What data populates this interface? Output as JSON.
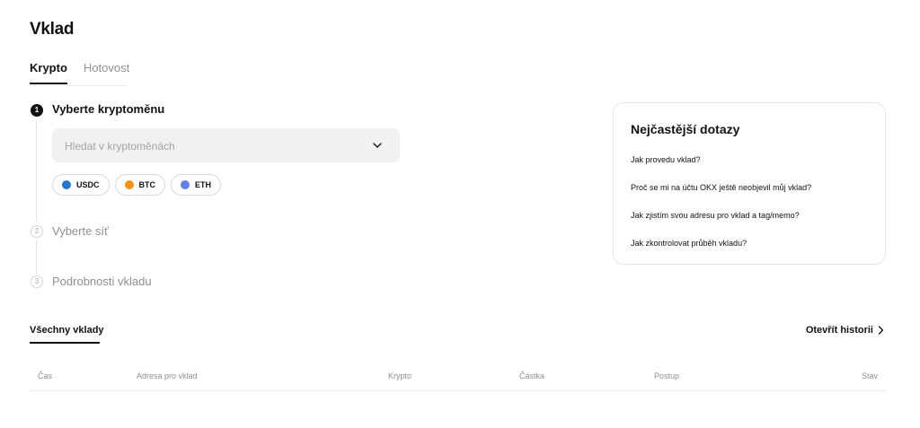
{
  "page": {
    "title": "Vklad"
  },
  "tabs": [
    {
      "label": "Krypto",
      "active": true
    },
    {
      "label": "Hotovost",
      "active": false
    }
  ],
  "steps": [
    {
      "number": "1",
      "title": "Vyberte kryptoměnu",
      "active": true
    },
    {
      "number": "2",
      "title": "Vyberte síť",
      "active": false
    },
    {
      "number": "3",
      "title": "Podrobnosti vkladu",
      "active": false
    }
  ],
  "search": {
    "placeholder": "Hledat v kryptoměnách",
    "value": ""
  },
  "quick_coins": [
    {
      "label": "USDC",
      "color": "#2775ca",
      "icon": "usdc-icon"
    },
    {
      "label": "BTC",
      "color": "#f7931a",
      "icon": "btc-icon"
    },
    {
      "label": "ETH",
      "color": "#627eea",
      "icon": "eth-icon"
    }
  ],
  "faq": {
    "title": "Nejčastější dotazy",
    "items": [
      "Jak provedu vklad?",
      "Proč se mi na účtu OKX ještě neobjevil můj vklad?",
      "Jak zjistím svou adresu pro vklad a tag/memo?",
      "Jak zkontrolovat průběh vkladu?"
    ]
  },
  "history": {
    "tab_label": "Všechny vklady",
    "open_label": "Otevřít historii",
    "columns": [
      "Čas",
      "Adresa pro vklad",
      "Krypto",
      "Částka",
      "Postup",
      "Stav"
    ]
  }
}
